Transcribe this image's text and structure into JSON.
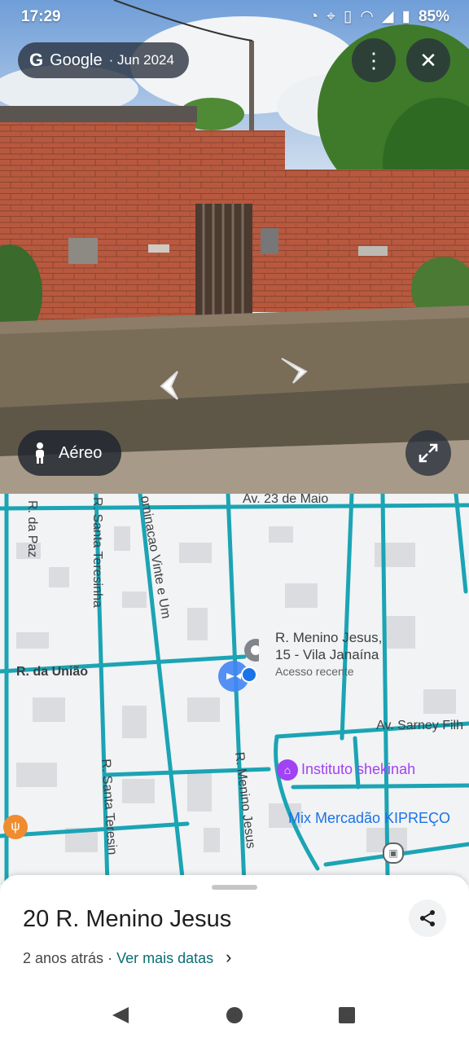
{
  "status_bar": {
    "time": "17:29",
    "battery": "85%"
  },
  "street_view": {
    "provider": "Google",
    "capture_date": "· Jun 2024",
    "aerial_label": "Aéreo"
  },
  "map": {
    "streets": [
      "Av. 23 de Maio",
      "R. da Paz",
      "R. Santa Teresinha",
      "ominacao Vinte e Um",
      "R. da União",
      "Av. Sarney Filh",
      "R. Santa Teresin",
      "R. Menino Jesus"
    ],
    "pin": {
      "line1": "R. Menino Jesus,",
      "line2": "15 - Vila Janaína",
      "sub": "Acesso recente"
    },
    "pois": [
      {
        "name": "Instituto shekinah",
        "color": "#a142f4"
      },
      {
        "name": "Mix Mercadão KIPREÇO",
        "color": "#1a73e8"
      }
    ],
    "road_color": "#1ba4b4"
  },
  "sheet": {
    "title": "20 R. Menino Jesus",
    "age": "2 anos atrás",
    "separator": " · ",
    "more_dates": "Ver mais datas",
    "chevron": "›"
  }
}
